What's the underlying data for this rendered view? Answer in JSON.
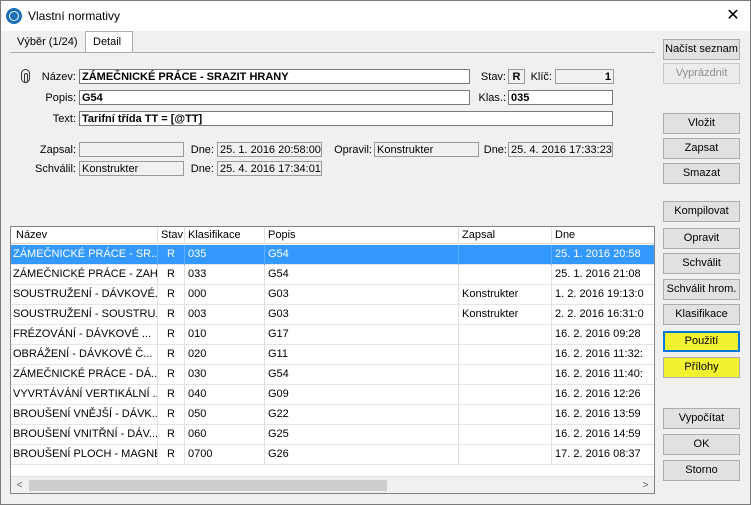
{
  "window": {
    "title": "Vlastní normativy",
    "close": "✕"
  },
  "tabs": [
    {
      "label": "Výběr (1/24)"
    },
    {
      "label": "Detail"
    }
  ],
  "detail": {
    "nazev_label": "Název:",
    "nazev_value": "ZÁMEČNICKÉ PRÁCE -  SRAZIT HRANY",
    "stav_label": "Stav:",
    "stav_value": "R",
    "klic_label": "Klíč:",
    "klic_value": "1",
    "popis_label": "Popis:",
    "popis_value": "G54",
    "klas_label": "Klas.:",
    "klas_value": "035",
    "text_label": "Text:",
    "text_value": "Tarifní třída TT = [@TT]",
    "zapsal_label": "Zapsal:",
    "zapsal_value": "",
    "dne1_label": "Dne:",
    "dne1_value": "25. 1. 2016 20:58:00",
    "opravil_label": "Opravil:",
    "opravil_value": "Konstrukter",
    "dne2_label": "Dne:",
    "dne2_value": "25. 4. 2016 17:33:23",
    "schvalil_label": "Schválil:",
    "schvalil_value": "Konstrukter",
    "dne3_label": "Dne:",
    "dne3_value": "25. 4. 2016 17:34:01"
  },
  "buttons": {
    "nacist_seznam": "Načíst seznam",
    "vyprazdnit": "Vyprázdnit",
    "vlozit": "Vložit",
    "zapsat": "Zapsat",
    "smazat": "Smazat",
    "kompilovat": "Kompilovat",
    "opravit": "Opravit",
    "schvalit": "Schválit",
    "schvalit_hrom": "Schválit hrom.",
    "klasifikace": "Klasifikace",
    "pouziti": "Použití",
    "prilohy": "Přílohy",
    "vypocitat": "Vypočítat",
    "ok": "OK",
    "storno": "Storno"
  },
  "highlight_color": "#f2f230",
  "selection_color": "#3399ff",
  "grid": {
    "columns": [
      "Název",
      "Stav",
      "Klasifikace",
      "Popis",
      "Zapsal",
      "Dne"
    ],
    "rows": [
      [
        "ZÁMEČNICKÉ PRÁCE -  SR...",
        "R",
        "035",
        "G54",
        "",
        "25. 1. 2016 20:58"
      ],
      [
        "ZÁMEČNICKÉ PRÁCE - ZAH...",
        "R",
        "033",
        "G54",
        "",
        "25. 1. 2016 21:08"
      ],
      [
        "SOUSTRUŽENÍ - DÁVKOVÉ...",
        "R",
        "000",
        "G03",
        "Konstrukter",
        "1. 2. 2016 19:13:0"
      ],
      [
        "SOUSTRUŽENÍ - SOUSTRU...",
        "R",
        "003",
        "G03",
        "Konstrukter",
        "2. 2. 2016 16:31:0"
      ],
      [
        "FRÉZOVÁNÍ  - DÁVKOVÉ ...",
        "R",
        "010",
        "G17",
        "",
        "16. 2. 2016 09:28"
      ],
      [
        "OBRÁŽENÍ  - DÁVKOVÉ Č...",
        "R",
        "020",
        "G11",
        "",
        "16. 2. 2016 11:32:"
      ],
      [
        "ZÁMEČNICKÉ PRÁCE - DÁ...",
        "R",
        "030",
        "G54",
        "",
        "16. 2. 2016 11:40:"
      ],
      [
        "VYVRTÁVÁNÍ VERTIKÁLNÍ ...",
        "R",
        "040",
        "G09",
        "",
        "16. 2. 2016 12:26"
      ],
      [
        "BROUŠENÍ VNĚJŠÍ -  DÁVK...",
        "R",
        "050",
        "G22",
        "",
        "16. 2. 2016 13:59"
      ],
      [
        "BROUŠENÍ VNITŘNÍ  -  DÁV...",
        "R",
        "060",
        "G25",
        "",
        "16. 2. 2016 14:59"
      ],
      [
        "BROUŠENÍ PLOCH - MAGNE...",
        "R",
        "0700",
        "G26",
        "",
        "17. 2. 2016 08:37"
      ]
    ]
  },
  "scroll": {
    "left": "<",
    "right": ">"
  }
}
